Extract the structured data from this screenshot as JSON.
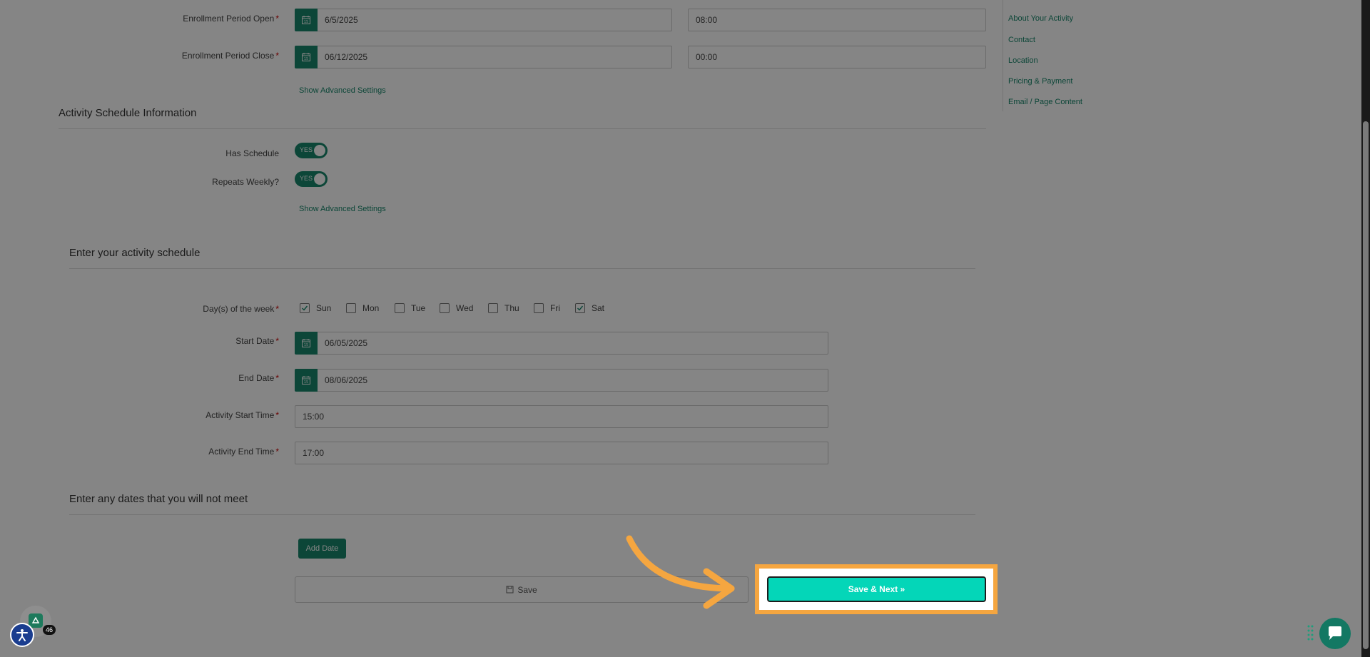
{
  "enrollment": {
    "open_label": "Enrollment Period Open",
    "open_date": "6/5/2025",
    "open_time": "08:00",
    "close_label": "Enrollment Period Close",
    "close_date": "06/12/2025",
    "close_time": "00:00",
    "advanced_link": "Show Advanced Settings",
    "required_mark": "*"
  },
  "schedule_info": {
    "title": "Activity Schedule Information",
    "has_schedule_label": "Has Schedule",
    "has_schedule_value": "YES",
    "repeats_weekly_label": "Repeats Weekly?",
    "repeats_weekly_value": "YES",
    "advanced_link": "Show Advanced Settings"
  },
  "activity_schedule": {
    "title": "Enter your activity schedule",
    "days_label": "Day(s) of the week",
    "days": [
      {
        "label": "Sun",
        "checked": true
      },
      {
        "label": "Mon",
        "checked": false
      },
      {
        "label": "Tue",
        "checked": false
      },
      {
        "label": "Wed",
        "checked": false
      },
      {
        "label": "Thu",
        "checked": false
      },
      {
        "label": "Fri",
        "checked": false
      },
      {
        "label": "Sat",
        "checked": true
      }
    ],
    "start_date_label": "Start Date",
    "start_date": "06/05/2025",
    "end_date_label": "End Date",
    "end_date": "08/06/2025",
    "start_time_label": "Activity Start Time",
    "start_time": "15:00",
    "end_time_label": "Activity End Time",
    "end_time": "17:00"
  },
  "skip_dates": {
    "title": "Enter any dates that you will not meet",
    "add_date_label": "Add Date"
  },
  "actions": {
    "save_label": "Save",
    "save_next_label": "Save & Next »"
  },
  "sidebar": {
    "items": [
      {
        "label": "About Your Activity"
      },
      {
        "label": "Contact"
      },
      {
        "label": "Location"
      },
      {
        "label": "Pricing & Payment"
      },
      {
        "label": "Email / Page Content"
      }
    ]
  },
  "widgets": {
    "badge_count": "46"
  },
  "colors": {
    "brand_green": "#17876b",
    "highlight_orange": "#f5a640",
    "next_button": "#04d6b8"
  }
}
